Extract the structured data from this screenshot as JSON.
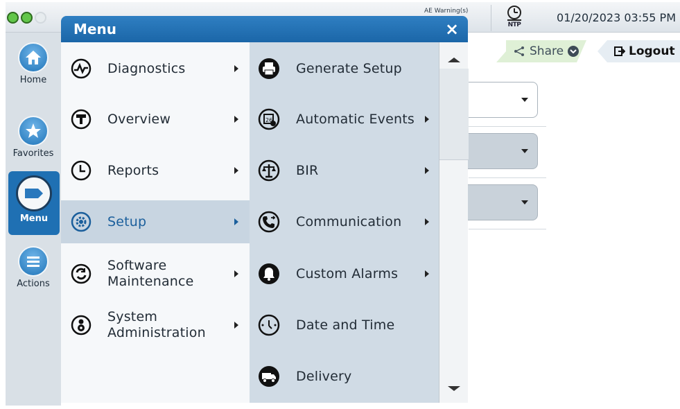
{
  "status": {
    "warning_text": "AE Warning(s)",
    "ntp_label": "NTP",
    "datetime": "01/20/2023 03:55 PM"
  },
  "sidebar": {
    "items": [
      {
        "label": "Home",
        "icon": "home-icon"
      },
      {
        "label": "Favorites",
        "icon": "star-icon"
      },
      {
        "label": "Menu",
        "icon": "menu-icon"
      },
      {
        "label": "Actions",
        "icon": "list-icon"
      }
    ]
  },
  "toolbar": {
    "share_label": "Share",
    "logout_label": "Logout"
  },
  "menu": {
    "title": "Menu",
    "close_label": "×",
    "items": [
      {
        "label": "Diagnostics",
        "icon": "diagnostics-icon",
        "selected": false
      },
      {
        "label": "Overview",
        "icon": "overview-icon",
        "selected": false
      },
      {
        "label": "Reports",
        "icon": "reports-icon",
        "selected": false
      },
      {
        "label": "Setup",
        "icon": "setup-gear-icon",
        "selected": true
      },
      {
        "label": "Software\nMaintenance",
        "icon": "software-maintenance-icon",
        "selected": false
      },
      {
        "label": "System\nAdministration",
        "icon": "system-administration-icon",
        "selected": false
      }
    ],
    "submenu": [
      {
        "label": "Generate Setup",
        "icon": "printer-icon",
        "has_submenu": false
      },
      {
        "label": "Automatic Events",
        "icon": "calendar-icon",
        "has_submenu": true
      },
      {
        "label": "BIR",
        "icon": "scales-icon",
        "has_submenu": true
      },
      {
        "label": "Communication",
        "icon": "phone-icon",
        "has_submenu": true
      },
      {
        "label": "Custom Alarms",
        "icon": "bell-icon",
        "has_submenu": true
      },
      {
        "label": "Date and Time",
        "icon": "clock-icon",
        "has_submenu": false
      },
      {
        "label": "Delivery",
        "icon": "truck-icon",
        "has_submenu": false
      }
    ]
  },
  "colors": {
    "header_blue": "#1f70b3",
    "status_green": "#62c64a",
    "selected_row": "#c8d5e1"
  }
}
